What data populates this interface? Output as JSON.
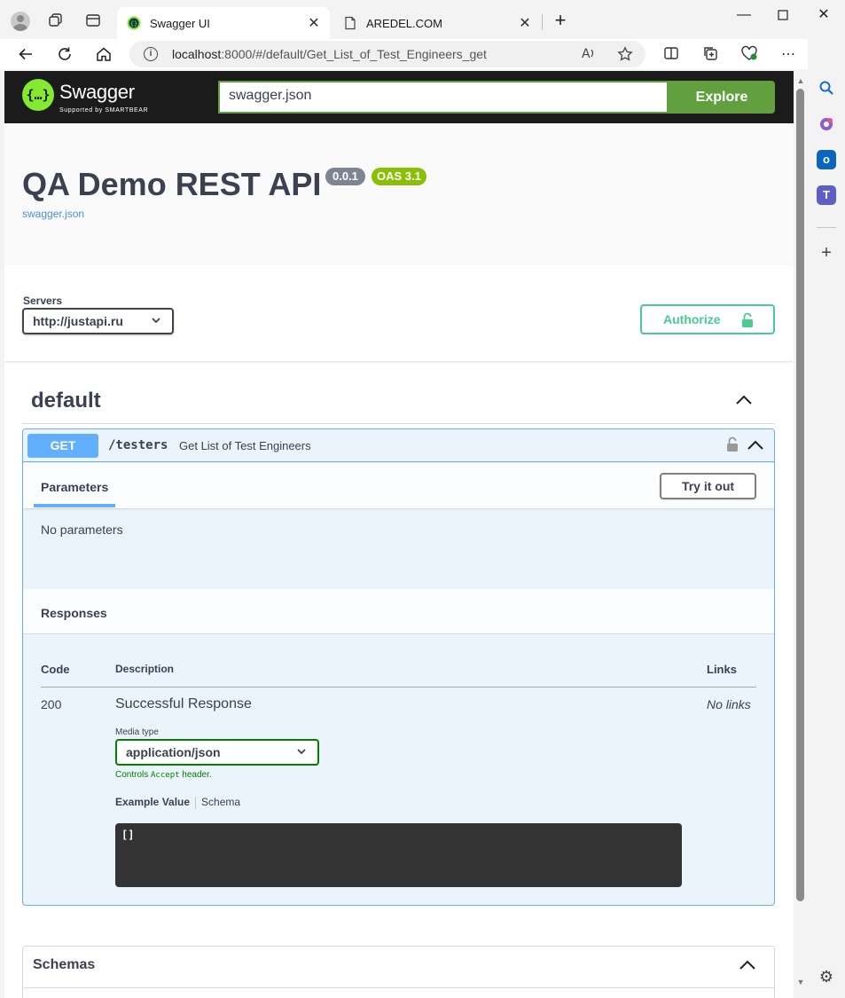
{
  "browser": {
    "tabs": [
      {
        "title": "Swagger UI",
        "active": true
      },
      {
        "title": "AREDEL.COM",
        "active": false
      }
    ],
    "address": {
      "host": "localhost",
      "rest": ":8000/#/default/Get_List_of_Test_Engineers_get"
    }
  },
  "swagger": {
    "brand": "Swagger",
    "brand_sub": "Supported by SMARTBEAR",
    "url_value": "swagger.json",
    "explore_label": "Explore"
  },
  "info": {
    "title": "QA Demo REST API",
    "version": "0.0.1",
    "oas": "OAS 3.1",
    "link": "swagger.json"
  },
  "servers": {
    "label": "Servers",
    "selected": "http://justapi.ru",
    "authorize_label": "Authorize"
  },
  "tag": {
    "name": "default"
  },
  "operation": {
    "method": "GET",
    "path": "/testers",
    "summary": "Get List of Test Engineers",
    "parameters_tab": "Parameters",
    "try_label": "Try it out",
    "no_params": "No parameters",
    "responses_title": "Responses",
    "columns": {
      "code": "Code",
      "description": "Description",
      "links": "Links"
    },
    "response": {
      "code": "200",
      "description": "Successful Response",
      "links": "No links",
      "media_label": "Media type",
      "media_value": "application/json",
      "controls_prefix": "Controls ",
      "controls_code": "Accept",
      "controls_suffix": " header.",
      "example_tab": "Example Value",
      "schema_tab": "Schema",
      "example": "[]"
    }
  },
  "schemas": {
    "title": "Schemas"
  },
  "colors": {
    "get": "#61affe",
    "green": "#49cc90",
    "explore": "#62a03f",
    "oas": "#89bf04"
  }
}
